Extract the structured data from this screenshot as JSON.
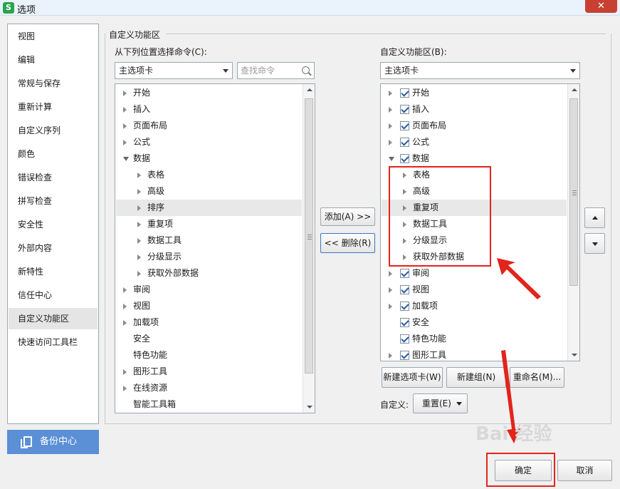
{
  "window": {
    "title": "选项",
    "close": "✕",
    "logo": "S"
  },
  "nav": {
    "items": [
      "视图",
      "编辑",
      "常规与保存",
      "重新计算",
      "自定义序列",
      "颜色",
      "错误检查",
      "拼写检查",
      "安全性",
      "外部内容",
      "新特性",
      "信任中心",
      "自定义功能区",
      "快速访问工具栏"
    ],
    "active_index": 12,
    "backup_label": "备份中心"
  },
  "group_title": "自定义功能区",
  "left": {
    "label": "从下列位置选择命令(C):",
    "combo_value": "主选项卡",
    "search_placeholder": "查找命令",
    "tree": [
      {
        "label": "开始",
        "level": 0,
        "expander": "closed"
      },
      {
        "label": "插入",
        "level": 0,
        "expander": "closed"
      },
      {
        "label": "页面布局",
        "level": 0,
        "expander": "closed"
      },
      {
        "label": "公式",
        "level": 0,
        "expander": "closed"
      },
      {
        "label": "数据",
        "level": 0,
        "expander": "open"
      },
      {
        "label": "表格",
        "level": 1,
        "expander": "closed"
      },
      {
        "label": "高级",
        "level": 1,
        "expander": "closed"
      },
      {
        "label": "排序",
        "level": 1,
        "expander": "closed",
        "selected": true
      },
      {
        "label": "重复项",
        "level": 1,
        "expander": "closed"
      },
      {
        "label": "数据工具",
        "level": 1,
        "expander": "closed"
      },
      {
        "label": "分级显示",
        "level": 1,
        "expander": "closed"
      },
      {
        "label": "获取外部数据",
        "level": 1,
        "expander": "closed"
      },
      {
        "label": "审阅",
        "level": 0,
        "expander": "closed"
      },
      {
        "label": "视图",
        "level": 0,
        "expander": "closed"
      },
      {
        "label": "加载项",
        "level": 0,
        "expander": "closed"
      },
      {
        "label": "安全",
        "level": 0,
        "expander": "none"
      },
      {
        "label": "特色功能",
        "level": 0,
        "expander": "none"
      },
      {
        "label": "图形工具",
        "level": 0,
        "expander": "closed"
      },
      {
        "label": "在线资源",
        "level": 0,
        "expander": "closed"
      },
      {
        "label": "智能工具箱",
        "level": 0,
        "expander": "none"
      }
    ]
  },
  "middle": {
    "add_label": "添加(A) >>",
    "remove_label": "<< 删除(R)"
  },
  "right": {
    "label": "自定义功能区(B):",
    "combo_value": "主选项卡",
    "tree": [
      {
        "label": "开始",
        "level": 0,
        "expander": "closed",
        "checked": true
      },
      {
        "label": "插入",
        "level": 0,
        "expander": "closed",
        "checked": true
      },
      {
        "label": "页面布局",
        "level": 0,
        "expander": "closed",
        "checked": true
      },
      {
        "label": "公式",
        "level": 0,
        "expander": "closed",
        "checked": true
      },
      {
        "label": "数据",
        "level": 0,
        "expander": "open",
        "checked": true
      },
      {
        "label": "表格",
        "level": 1,
        "expander": "closed"
      },
      {
        "label": "高级",
        "level": 1,
        "expander": "closed"
      },
      {
        "label": "重复项",
        "level": 1,
        "expander": "closed",
        "selected": true
      },
      {
        "label": "数据工具",
        "level": 1,
        "expander": "closed"
      },
      {
        "label": "分级显示",
        "level": 1,
        "expander": "closed"
      },
      {
        "label": "获取外部数据",
        "level": 1,
        "expander": "closed"
      },
      {
        "label": "审阅",
        "level": 0,
        "expander": "closed",
        "checked": true
      },
      {
        "label": "视图",
        "level": 0,
        "expander": "closed",
        "checked": true
      },
      {
        "label": "加载项",
        "level": 0,
        "expander": "closed",
        "checked": true
      },
      {
        "label": "安全",
        "level": 0,
        "expander": "none",
        "checked": true
      },
      {
        "label": "特色功能",
        "level": 0,
        "expander": "none",
        "checked": true
      },
      {
        "label": "图形工具",
        "level": 0,
        "expander": "closed",
        "checked": true
      }
    ],
    "new_tab_label": "新建选项卡(W)",
    "new_group_label": "新建组(N)",
    "rename_label": "重命名(M)...",
    "customize_label": "自定义:",
    "reset_label": "重置(E)"
  },
  "footer": {
    "ok_label": "确定",
    "cancel_label": "取消"
  },
  "watermark": "Bai 经验",
  "colors": {
    "highlight": "#e2241b",
    "backup": "#5b8fd6",
    "logo": "#2aa44f"
  }
}
